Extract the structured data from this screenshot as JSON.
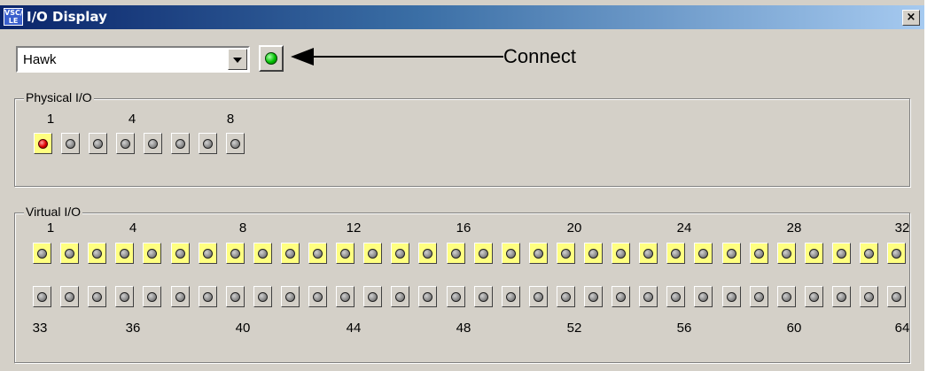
{
  "window": {
    "title": "I/O Display",
    "icon_text": "VSC/ LE",
    "close_glyph": "×"
  },
  "device": {
    "selected": "Hawk",
    "connected": true
  },
  "callout": {
    "label": "Connect"
  },
  "physical_io": {
    "label": "Physical I/O",
    "numbers": [
      "1",
      "4",
      "8"
    ],
    "outputs": [
      {
        "state": "on",
        "highlighted": true
      },
      {
        "state": "off",
        "highlighted": false
      },
      {
        "state": "off",
        "highlighted": false
      },
      {
        "state": "off",
        "highlighted": false
      },
      {
        "state": "off",
        "highlighted": false
      },
      {
        "state": "off",
        "highlighted": false
      },
      {
        "state": "off",
        "highlighted": false
      },
      {
        "state": "off",
        "highlighted": false
      }
    ]
  },
  "virtual_io": {
    "label": "Virtual I/O",
    "top_numbers": [
      "1",
      "4",
      "8",
      "12",
      "16",
      "20",
      "24",
      "28",
      "32"
    ],
    "bottom_numbers": [
      "33",
      "36",
      "40",
      "44",
      "48",
      "52",
      "56",
      "60",
      "64"
    ],
    "row1_highlighted": true,
    "row2_highlighted": false,
    "count_per_row": 32
  },
  "colors": {
    "led_on": "#e00000",
    "led_off": "#8a8a8a",
    "connect_led": "#00c000",
    "highlight": "#ffff80"
  }
}
